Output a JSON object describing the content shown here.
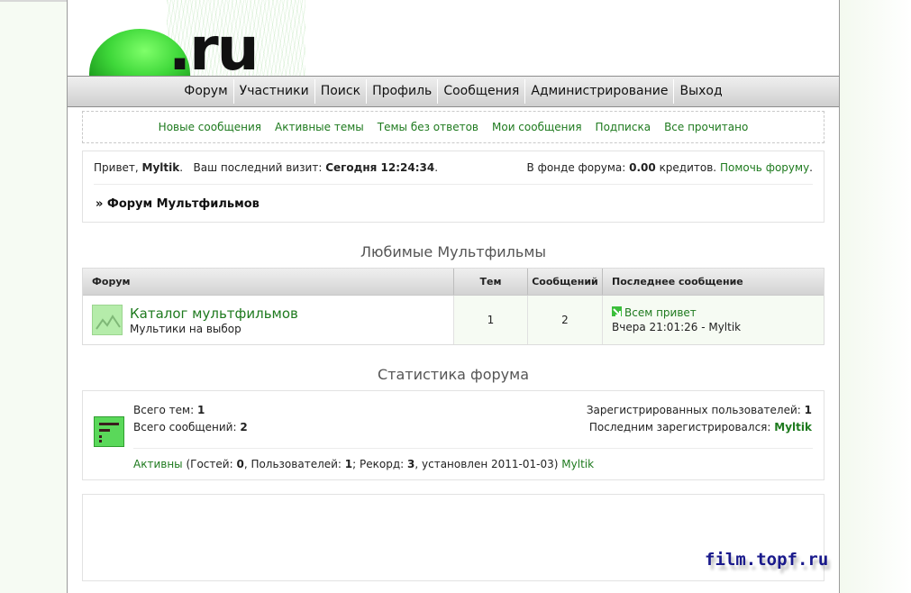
{
  "logo": {
    "text": ".ru"
  },
  "nav": {
    "items": [
      "Форум",
      "Участники",
      "Поиск",
      "Профиль",
      "Сообщения",
      "Администрирование",
      "Выход"
    ]
  },
  "subnav": {
    "items": [
      "Новые сообщения",
      "Активные темы",
      "Темы без ответов",
      "Мои сообщения",
      "Подписка",
      "Все прочитано"
    ]
  },
  "welcome": {
    "greeting": "Привет,",
    "username": "Myltik",
    "last_visit_label": "Ваш последний визит:",
    "last_visit_value": "Сегодня 12:24:34",
    "fund_label": "В фонде форума:",
    "fund_value": "0.00",
    "fund_unit": "кредитов.",
    "help_link": "Помочь форуму",
    "breadcrumb": "» Форум Мультфильмов"
  },
  "category": {
    "title": "Любимые Мультфильмы",
    "columns": [
      "Форум",
      "Тем",
      "Сообщений",
      "Последнее сообщение"
    ],
    "forums": [
      {
        "name": "Каталог мультфильмов",
        "description": "Мультики на выбор",
        "topics": "1",
        "posts": "2",
        "last_post_title": "Всем привет",
        "last_post_meta": "Вчера 21:01:26 - Myltik"
      }
    ]
  },
  "stats": {
    "title": "Статистика форума",
    "total_topics_label": "Всего тем:",
    "total_topics": "1",
    "total_posts_label": "Всего сообщений:",
    "total_posts": "2",
    "registered_label": "Зарегистрированных пользователей:",
    "registered": "1",
    "last_registered_label": "Последним зарегистрировался:",
    "last_registered": "Myltik",
    "active_link": "Активны",
    "guests_label": "(Гостей:",
    "guests": "0",
    "users_label": ", Пользователей:",
    "users": "1",
    "record_label": "; Рекорд:",
    "record": "3",
    "record_date": ", установлен 2011-01-03)",
    "active_user": "Myltik"
  },
  "watermark": "film.topf.ru"
}
